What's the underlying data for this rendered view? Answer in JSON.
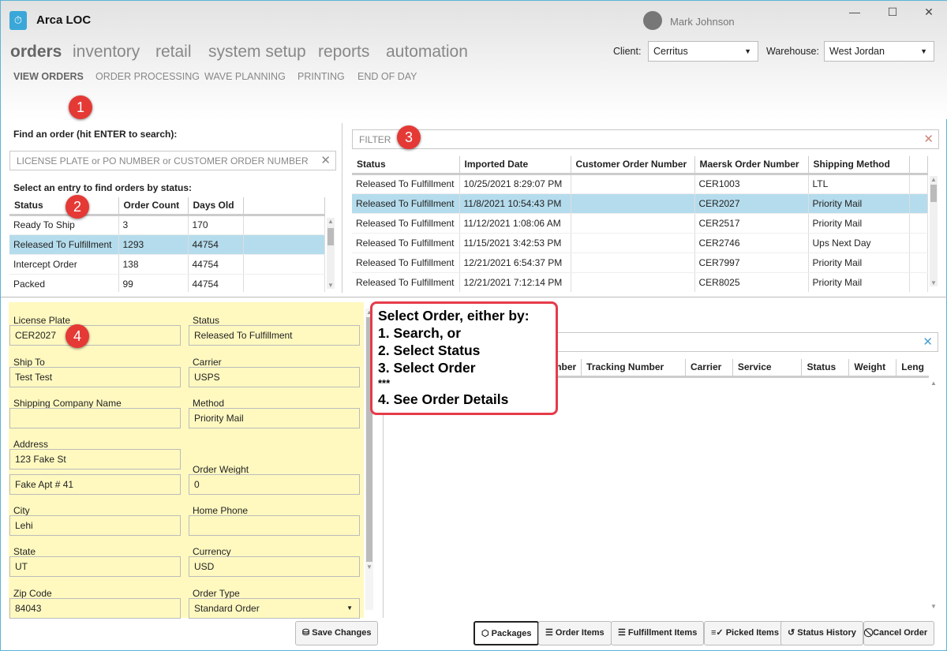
{
  "app": {
    "title": "Arca LOC",
    "user": "Mark Johnson"
  },
  "nav": [
    "orders",
    "inventory",
    "retail",
    "system setup",
    "reports",
    "automation"
  ],
  "subnav": [
    "VIEW ORDERS",
    "ORDER PROCESSING",
    "WAVE PLANNING",
    "PRINTING",
    "END OF DAY"
  ],
  "client": {
    "label": "Client:",
    "value": "Cerritus"
  },
  "warehouse": {
    "label": "Warehouse:",
    "value": "West Jordan"
  },
  "search": {
    "label": "Find an order (hit ENTER to search):",
    "placeholder": "LICENSE PLATE or PO NUMBER or CUSTOMER ORDER NUMBER"
  },
  "status_table": {
    "label": "Select an entry to find orders by status:",
    "headers": [
      "Status",
      "Order Count",
      "Days Old"
    ],
    "rows": [
      [
        "Ready To Ship",
        "3",
        "170"
      ],
      [
        "Released To Fulfillment",
        "1293",
        "44754"
      ],
      [
        "Intercept Order",
        "138",
        "44754"
      ],
      [
        "Packed",
        "99",
        "44754"
      ]
    ],
    "selected": 1
  },
  "filter": {
    "placeholder": "FILTER"
  },
  "orders_table": {
    "headers": [
      "Status",
      "Imported Date",
      "Customer Order Number",
      "Maersk Order Number",
      "Shipping Method"
    ],
    "rows": [
      [
        "Released To Fulfillment",
        "10/25/2021 8:29:07 PM",
        "",
        "CER1003",
        "LTL"
      ],
      [
        "Released To Fulfillment",
        "11/8/2021 10:54:43 PM",
        "",
        "CER2027",
        "Priority Mail"
      ],
      [
        "Released To Fulfillment",
        "11/12/2021 1:08:06 AM",
        "",
        "CER2517",
        "Priority Mail"
      ],
      [
        "Released To Fulfillment",
        "11/15/2021 3:42:53 PM",
        "",
        "CER2746",
        "Ups Next Day"
      ],
      [
        "Released To Fulfillment",
        "12/21/2021 6:54:37 PM",
        "",
        "CER7997",
        "Priority Mail"
      ],
      [
        "Released To Fulfillment",
        "12/21/2021 7:12:14 PM",
        "",
        "CER8025",
        "Priority Mail"
      ]
    ],
    "selected": 1
  },
  "details": {
    "license_plate": {
      "label": "License Plate",
      "value": "CER2027"
    },
    "status": {
      "label": "Status",
      "value": "Released To Fulfillment"
    },
    "ship_to": {
      "label": "Ship To",
      "value": "Test Test"
    },
    "carrier": {
      "label": "Carrier",
      "value": "USPS"
    },
    "shipping_company": {
      "label": "Shipping Company Name",
      "value": ""
    },
    "method": {
      "label": "Method",
      "value": "Priority Mail"
    },
    "address": {
      "label": "Address",
      "value1": "123 Fake St",
      "value2": "Fake Apt # 41"
    },
    "order_weight": {
      "label": "Order Weight",
      "value": "0"
    },
    "city": {
      "label": "City",
      "value": "Lehi"
    },
    "home_phone": {
      "label": "Home Phone",
      "value": ""
    },
    "state": {
      "label": "State",
      "value": "UT"
    },
    "currency": {
      "label": "Currency",
      "value": "USD"
    },
    "zip": {
      "label": "Zip Code",
      "value": "84043"
    },
    "order_type": {
      "label": "Order Type",
      "value": "Standard Order"
    }
  },
  "save_label": "Save Changes",
  "packages_table": {
    "headers": [
      "mber",
      "Tracking Number",
      "Carrier",
      "Service",
      "Status",
      "Weight",
      "Leng"
    ]
  },
  "buttons": [
    "Packages",
    "Order Items",
    "Fulfillment Items",
    "Picked Items",
    "Status History",
    "Cancel Order"
  ],
  "callout": {
    "lines": [
      "Select Order, either by:",
      "1. Search, or",
      "2. Select Status",
      "3. Select Order",
      "***",
      "4. See Order Details"
    ]
  },
  "badges": [
    "1",
    "2",
    "3",
    "4"
  ],
  "colors": {
    "accent": "#3aa7d8",
    "selected_row": "#b5dcec",
    "form_bg": "#fff9c0",
    "callout": "#e53b4a"
  }
}
